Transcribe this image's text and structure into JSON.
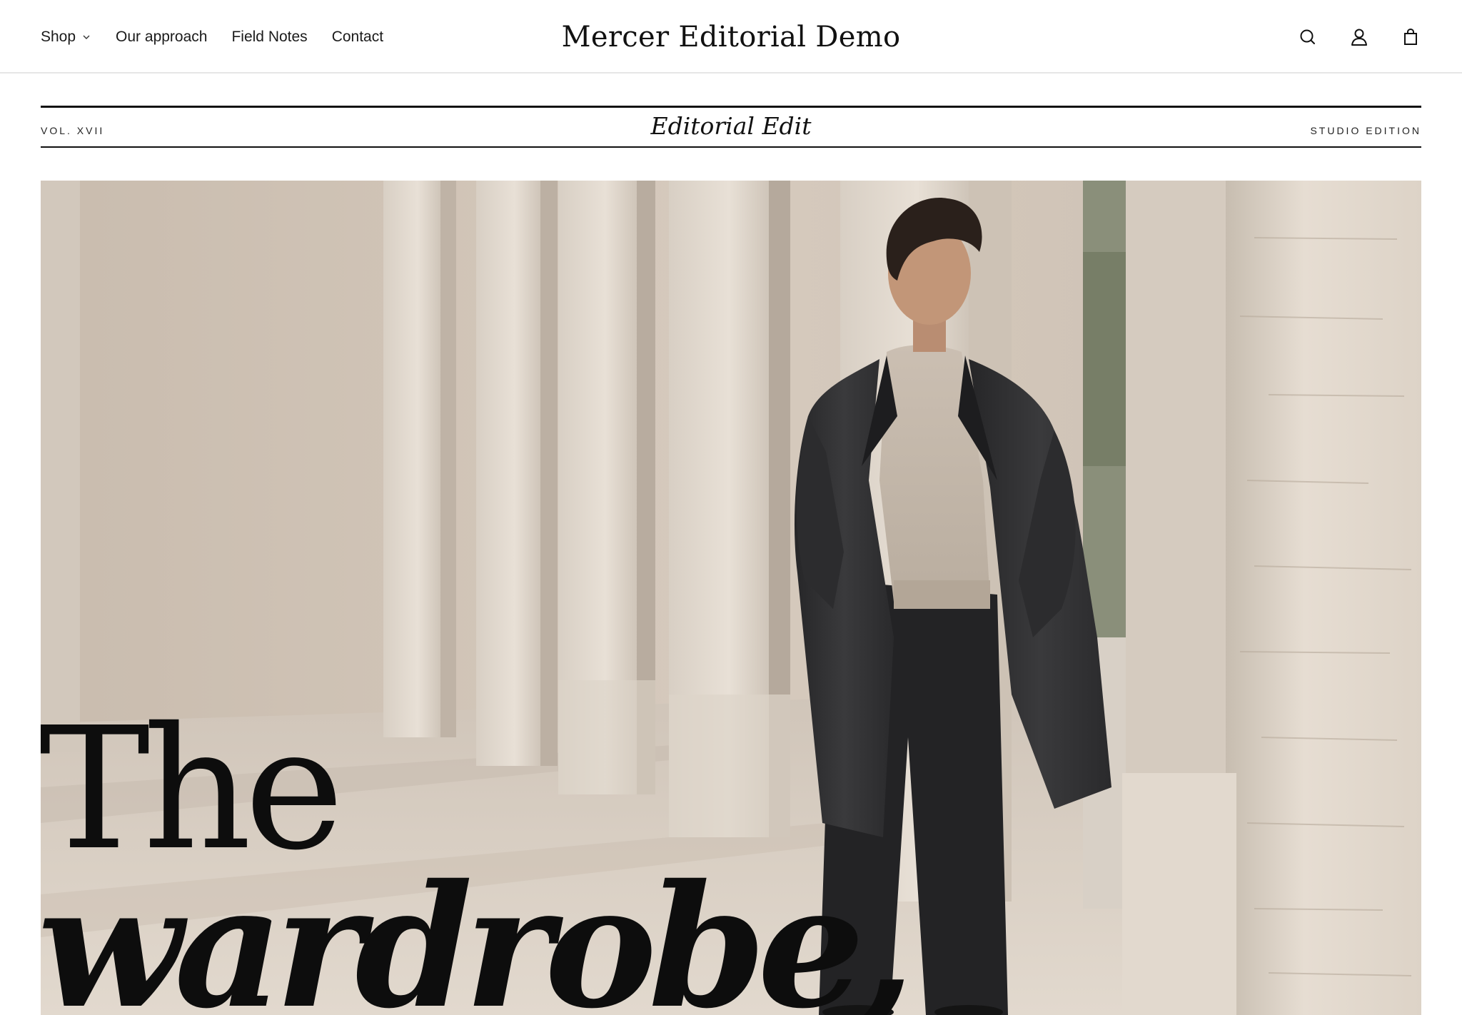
{
  "header": {
    "brand": "Mercer Editorial Demo",
    "nav": [
      {
        "label": "Shop",
        "has_dropdown": true
      },
      {
        "label": "Our approach"
      },
      {
        "label": "Field Notes"
      },
      {
        "label": "Contact"
      }
    ],
    "icons": [
      "search-icon",
      "account-icon",
      "bag-icon"
    ]
  },
  "masthead": {
    "volume": "VOL. XVII",
    "title": "Editorial Edit",
    "edition": "STUDIO EDITION"
  },
  "hero": {
    "headline_line1": "The",
    "headline_line2": "wardrobe,",
    "image": "Man in charcoal overcoat and oatmeal sweater walking through a travertine colonnade"
  },
  "colors": {
    "text": "#111111",
    "background": "#ffffff",
    "stone": "#d9cfc3",
    "coat": "#2b2b2d"
  }
}
